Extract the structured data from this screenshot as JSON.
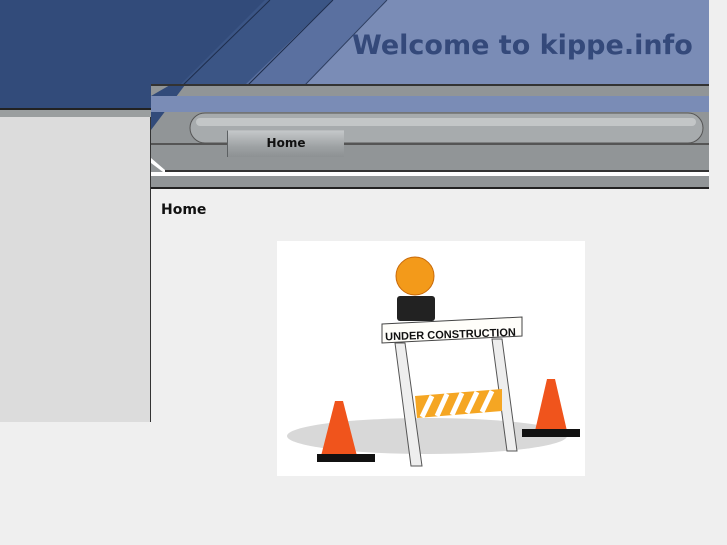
{
  "header": {
    "title": "Welcome to kippe.info"
  },
  "nav": {
    "items": [
      {
        "label": "Home"
      }
    ]
  },
  "main": {
    "heading": "Home",
    "image": {
      "sign_text": "UNDER CONSTRUCTION"
    }
  },
  "colors": {
    "dark_blue": "#324b7a",
    "light_blue": "#7a8cb6",
    "nav_gray": "#919597",
    "page_bg": "#efefef"
  }
}
